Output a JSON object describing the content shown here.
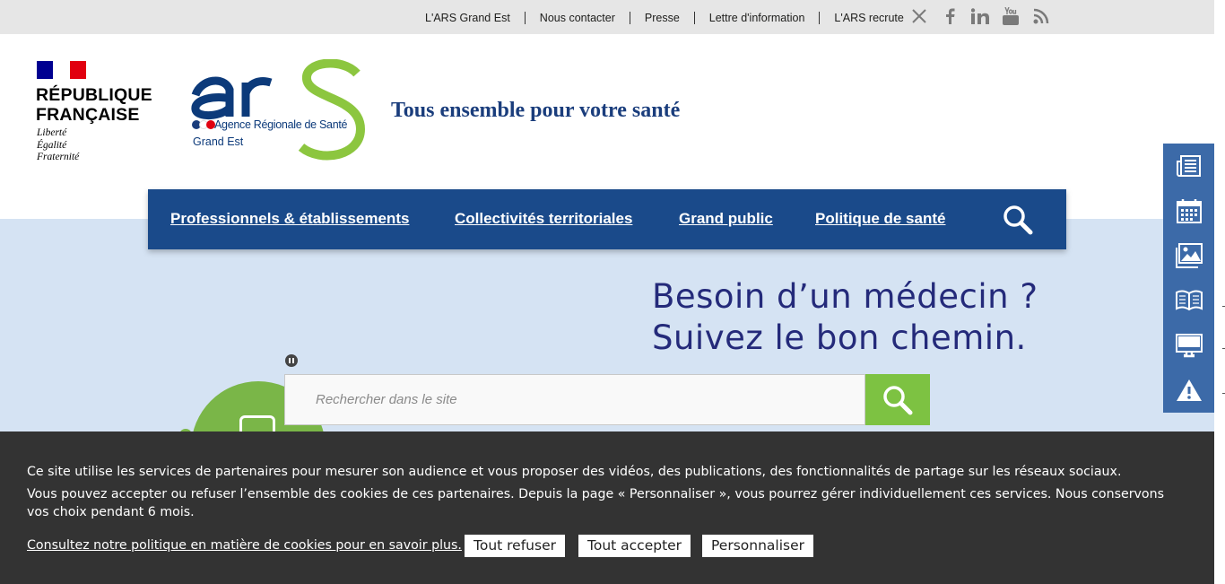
{
  "topbar": {
    "links": [
      "L'ARS Grand Est",
      "Nous contacter",
      "Presse",
      "Lettre d'information",
      "L'ARS recrute"
    ],
    "socials": [
      "x-icon",
      "facebook-icon",
      "linkedin-icon",
      "youtube-icon",
      "rss-icon"
    ]
  },
  "republique": {
    "name_line1": "RÉPUBLIQUE",
    "name_line2": "FRANÇAISE",
    "motto1": "Liberté",
    "motto2": "Égalité",
    "motto3": "Fraternité"
  },
  "ars": {
    "logo_text": "arS",
    "subtitle": "Agence Régionale de Santé",
    "region": "Grand Est",
    "tagline": "Tous ensemble pour votre santé"
  },
  "nav": {
    "items": [
      "Professionnels & établissements",
      "Collectivités territoriales",
      "Grand public",
      "Politique de santé"
    ]
  },
  "hero": {
    "title_line1": "Besoin d’un médecin ?",
    "title_line2": "Suivez le bon chemin."
  },
  "search": {
    "placeholder": "Rechercher dans le site"
  },
  "sidetools": [
    "newspaper-icon",
    "calendar-icon",
    "gallery-icon",
    "book-icon",
    "monitor-icon",
    "warning-icon"
  ],
  "cookie": {
    "text1": "Ce site utilise les services de partenaires pour mesurer son audience et vous proposer des vidéos, des publications, des fonctionnalités de partage sur les réseaux sociaux.",
    "text2": "Vous pouvez accepter ou refuser l’ensemble des cookies de ces partenaires. Depuis la page « Personnaliser », vous pourrez gérer individuellement ces services. Nous conservons vos choix pendant 6 mois.",
    "policy_link": "Consultez notre politique en matière de cookies pour en savoir plus.",
    "refuse": "Tout refuser",
    "accept": "Tout accepter",
    "customize": "Personnaliser"
  },
  "colors": {
    "nav_blue": "#1a4a8a",
    "ars_green": "#7dc242",
    "hero_bg": "#d5e3f3",
    "cookie_bg": "#333333"
  }
}
